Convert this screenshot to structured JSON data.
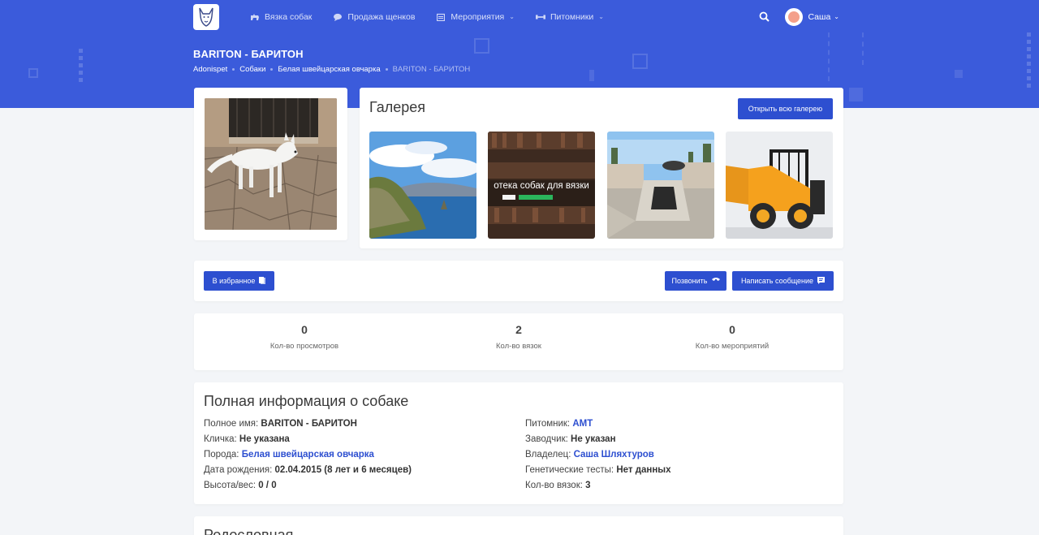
{
  "nav": {
    "items": [
      {
        "label": "Вязка собак",
        "icon": "dog-icon"
      },
      {
        "label": "Продажа щенков",
        "icon": "chat-bubble-icon"
      },
      {
        "label": "Мероприятия",
        "icon": "calendar-icon"
      },
      {
        "label": "Питомники",
        "icon": "dumbbell-icon"
      }
    ],
    "user_name": "Саша"
  },
  "header": {
    "title": "BARITON - БАРИТОН",
    "breadcrumbs": [
      "Adonispet",
      "Собаки",
      "Белая швейцарская овчарка",
      "BARITON - БАРИТОН"
    ]
  },
  "gallery": {
    "title": "Галерея",
    "open_button": "Открыть всю галерею",
    "library_caption": "отека собак для вязки"
  },
  "actions": {
    "favorite": "В избранное",
    "call": "Позвонить",
    "message": "Написать сообщение"
  },
  "stats": [
    {
      "value": "0",
      "label": "Кол-во просмотров"
    },
    {
      "value": "2",
      "label": "Кол-во вязок"
    },
    {
      "value": "0",
      "label": "Кол-во мероприятий"
    }
  ],
  "info": {
    "title": "Полная информация о собаке",
    "left": [
      {
        "label": "Полное имя:",
        "value": "BARITON - БАРИТОН",
        "link": false
      },
      {
        "label": "Кличка:",
        "value": "Не указана",
        "link": false
      },
      {
        "label": "Порода:",
        "value": "Белая швейцарская овчарка",
        "link": true
      },
      {
        "label": "Дата рождения:",
        "value": "02.04.2015 (8 лет и 6 месяцев)",
        "link": false
      },
      {
        "label": "Высота/вес:",
        "value": "0 / 0",
        "link": false
      }
    ],
    "right": [
      {
        "label": "Питомник:",
        "value": "AMT",
        "link": true
      },
      {
        "label": "Заводчик:",
        "value": "Не указан",
        "link": false
      },
      {
        "label": "Владелец:",
        "value": "Саша Шляхтуров",
        "link": true
      },
      {
        "label": "Генетические тесты:",
        "value": "Нет данных",
        "link": false
      },
      {
        "label": "Кол-во вязок:",
        "value": "3",
        "link": false
      }
    ]
  },
  "pedigree": {
    "title": "Родословная"
  },
  "colors": {
    "brand": "#3b5bdb",
    "button": "#2d4fd0",
    "link": "#2d4fd0"
  }
}
